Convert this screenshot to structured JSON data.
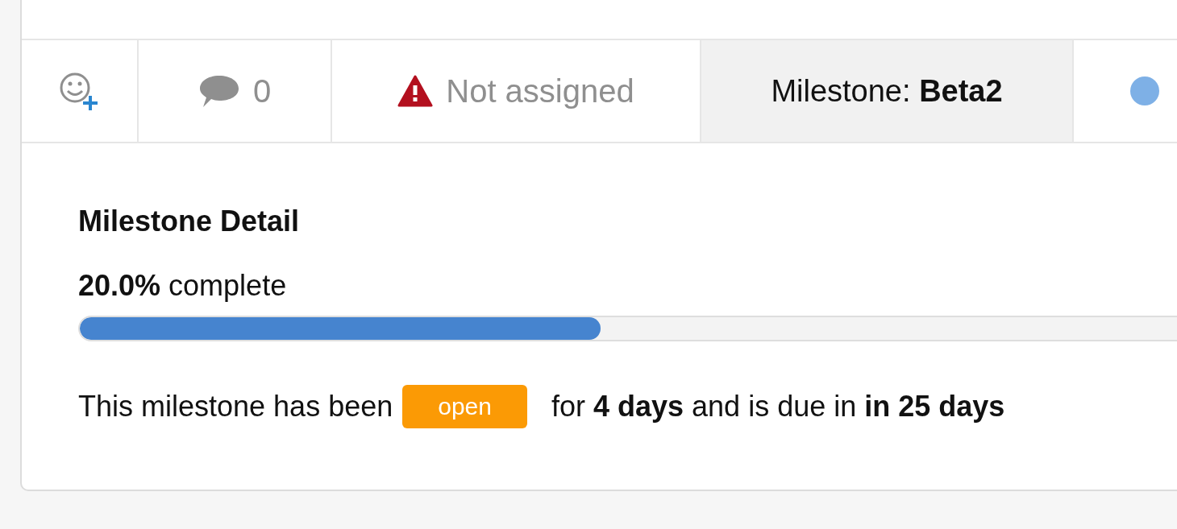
{
  "tabs": [
    {
      "kind": "reactions",
      "selected": false
    },
    {
      "kind": "comments",
      "count": "0",
      "selected": false
    },
    {
      "kind": "assignee",
      "label": "Not assigned",
      "selected": false
    },
    {
      "kind": "milestone",
      "label": "Milestone: **Beta2**",
      "selected": true
    },
    {
      "kind": "label",
      "color": "#7eb0e6",
      "selected": false
    }
  ],
  "milestone_detail": {
    "title": "Milestone Detail",
    "progress_text": "**20.0%** complete",
    "level": 0.2,
    "status_prefix": "This milestone has been",
    "status_badge": "open",
    "status_suffix": "for **4 days** and is due in **in 25 days**"
  }
}
